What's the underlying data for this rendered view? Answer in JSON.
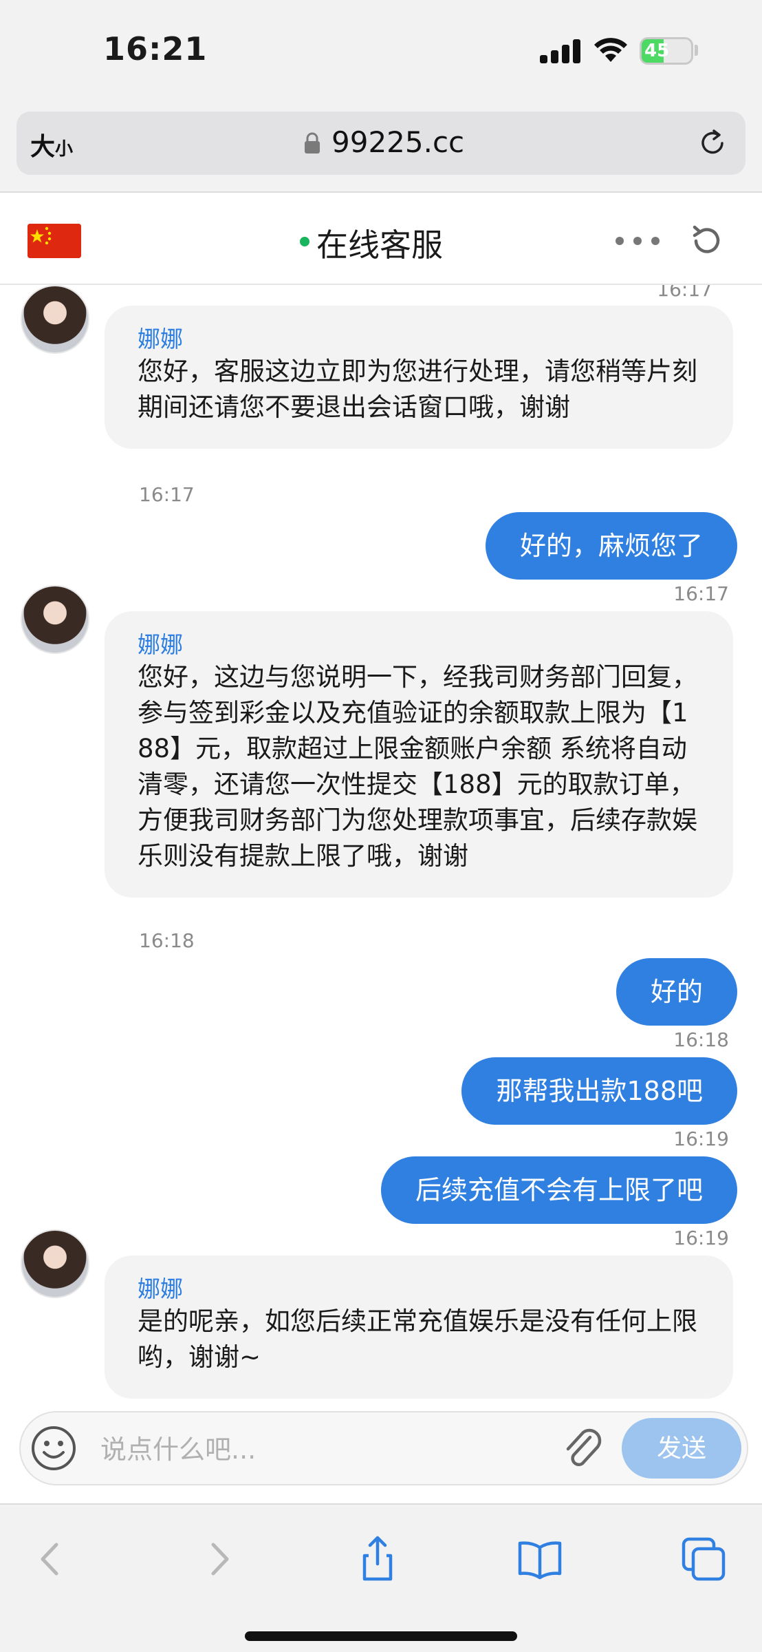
{
  "status_bar": {
    "time": "16:21",
    "battery_level": "45",
    "battery_percent": 45
  },
  "browser": {
    "text_size_label_big": "大",
    "text_size_label_small": "小",
    "url": "99225.cc"
  },
  "chat_header": {
    "title": "在线客服",
    "online_color": "#19b45e"
  },
  "messages": [
    {
      "type": "in",
      "sender": "",
      "text": "",
      "time": "16:17"
    },
    {
      "type": "in",
      "sender": "娜娜",
      "text": "您好，客服这边立即为您进行处理，请您稍等片刻期间还请您不要退出会话窗口哦，谢谢",
      "time": "16:17"
    },
    {
      "type": "out",
      "text": "好的，麻烦您了",
      "time": "16:17"
    },
    {
      "type": "in",
      "sender": "娜娜",
      "text": "您好，这边与您说明一下，经我司财务部门回复，参与签到彩金以及充值验证的余额取款上限为【188】元，取款超过上限金额账户余额 系统将自动清零，还请您一次性提交【188】元的取款订单，方便我司财务部门为您处理款项事宜，后续存款娱乐则没有提款上限了哦，谢谢",
      "time": "16:18"
    },
    {
      "type": "out",
      "text": "好的",
      "time": "16:18"
    },
    {
      "type": "out",
      "text": "那帮我出款188吧",
      "time": "16:19"
    },
    {
      "type": "out",
      "text": "后续充值不会有上限了吧",
      "time": "16:19"
    },
    {
      "type": "in",
      "sender": "娜娜",
      "text": "是的呢亲，如您后续正常充值娱乐是没有任何上限哟，谢谢~",
      "time": ""
    }
  ],
  "input": {
    "placeholder": "说点什么吧...",
    "value": "",
    "send_label": "发送"
  },
  "colors": {
    "accent": "#2f80e1",
    "send_disabled": "#9dc3ef",
    "sender_name": "#2c7ee0",
    "incoming_bubble": "#f3f3f4"
  },
  "icons": [
    "lock-icon",
    "reload-icon",
    "china-flag-icon",
    "more-icon",
    "refresh-icon",
    "emoji-icon",
    "attach-icon",
    "back-icon",
    "forward-icon",
    "share-icon",
    "bookmarks-icon",
    "tabs-icon"
  ]
}
